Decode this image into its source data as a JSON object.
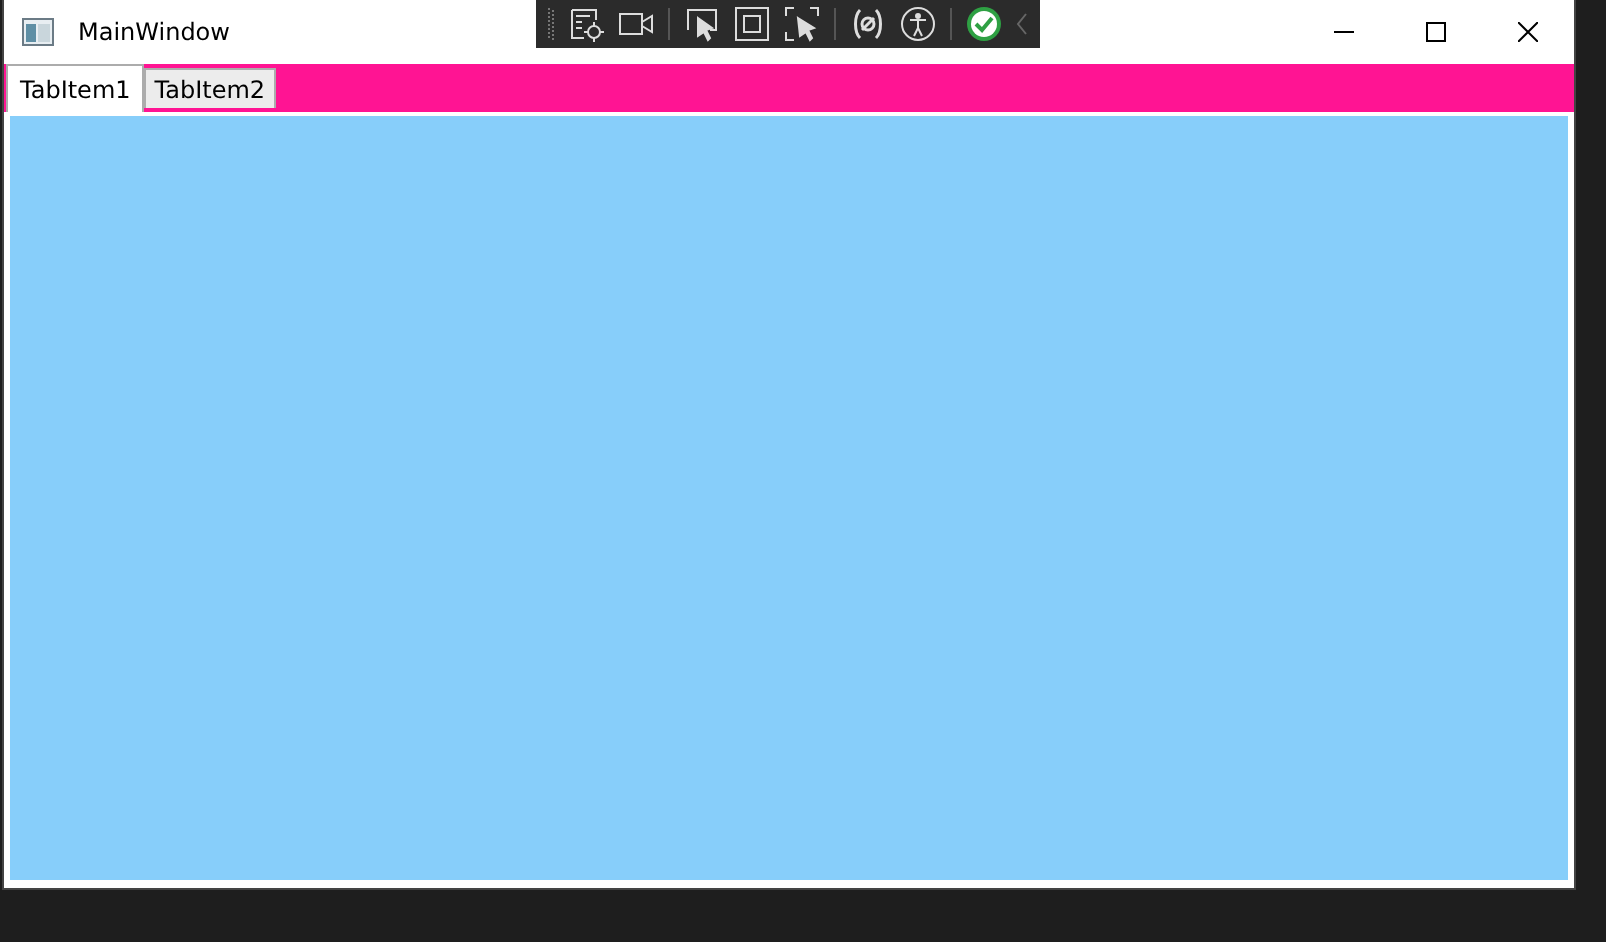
{
  "window": {
    "title": "MainWindow"
  },
  "tabs": [
    {
      "label": "TabItem1",
      "selected": true
    },
    {
      "label": "TabItem2",
      "selected": false
    }
  ]
}
